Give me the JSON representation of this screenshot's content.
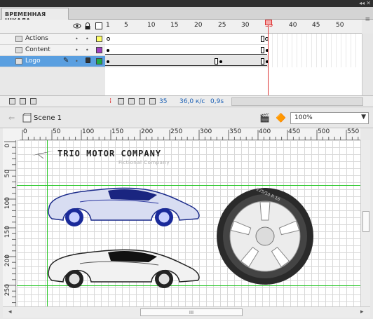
{
  "panel": {
    "tab_label": "ВРЕМЕННАЯ ШКАЛА",
    "collapse_glyph": "◂◂",
    "close_glyph": "✕",
    "menu_glyph": "≡"
  },
  "timeline": {
    "frame_numbers": [
      "1",
      "5",
      "10",
      "15",
      "20",
      "25",
      "30",
      "35",
      "40",
      "45",
      "50"
    ],
    "current_frame": "35",
    "layers": [
      {
        "name": "Actions",
        "color": "#ffff66"
      },
      {
        "name": "Content",
        "color": "#a040c0"
      },
      {
        "name": "Logo",
        "color": "#22aa44",
        "selected": true
      }
    ],
    "footer": {
      "current_frame": "35",
      "fps": "36,0 к/с",
      "elapsed": "0,9s"
    }
  },
  "scene": {
    "name": "Scene 1",
    "zoom": "100%"
  },
  "rulers": {
    "h": [
      "0",
      "50",
      "100",
      "150",
      "200",
      "250",
      "300",
      "350",
      "400",
      "450",
      "500",
      "550"
    ],
    "v": [
      "0",
      "50",
      "100",
      "150",
      "200",
      "250"
    ]
  },
  "stage": {
    "logo_title": "TRIO MOTOR COMPANY",
    "logo_subtitle": "Fictional Company",
    "tire_text": "225/50 R 16"
  },
  "colors": {
    "accent_selected": "#5a9fe0",
    "playhead": "#dd3333",
    "guide": "#2ec82e"
  },
  "scroll": {
    "thumb_glyph": "III"
  }
}
